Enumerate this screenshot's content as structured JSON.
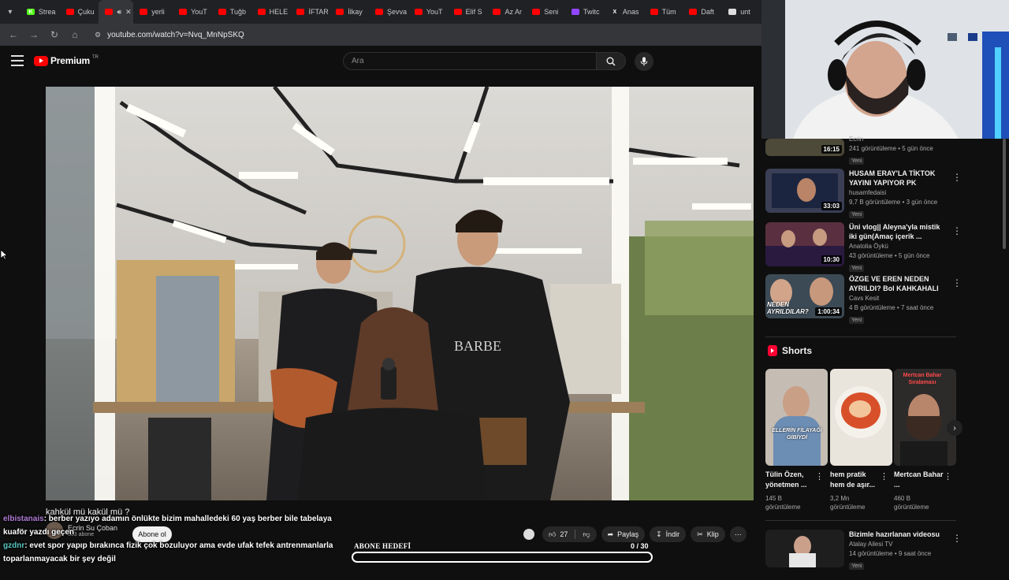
{
  "tabs": [
    {
      "label": "Strea",
      "fav": "K",
      "color": "#53fc18"
    },
    {
      "label": "Çuku",
      "fav": "",
      "color": "#ff0000"
    },
    {
      "label": "",
      "fav": "",
      "color": "#ff0000",
      "active": true
    },
    {
      "label": "yerli",
      "fav": "",
      "color": "#ff0000"
    },
    {
      "label": "YouT",
      "fav": "",
      "color": "#ff0000"
    },
    {
      "label": "Tuğb",
      "fav": "",
      "color": "#ff0000"
    },
    {
      "label": "HELE",
      "fav": "",
      "color": "#ff0000"
    },
    {
      "label": "İFTAR",
      "fav": "",
      "color": "#ff0000"
    },
    {
      "label": "İlkay",
      "fav": "",
      "color": "#ff0000"
    },
    {
      "label": "Şevva",
      "fav": "",
      "color": "#ff0000"
    },
    {
      "label": "YouT",
      "fav": "",
      "color": "#ff0000"
    },
    {
      "label": "Elif S",
      "fav": "",
      "color": "#ff0000"
    },
    {
      "label": "Az Ar",
      "fav": "",
      "color": "#ff0000"
    },
    {
      "label": "Seni",
      "fav": "",
      "color": "#ff0000"
    },
    {
      "label": "Twitc",
      "fav": "",
      "color": "#9146ff"
    },
    {
      "label": "Anas",
      "fav": "X",
      "color": "#202124"
    },
    {
      "label": "Tüm",
      "fav": "",
      "color": "#ff0000"
    },
    {
      "label": "Daft",
      "fav": "",
      "color": "#ff0000"
    },
    {
      "label": "unt",
      "fav": "",
      "color": "#dddddd"
    }
  ],
  "address": {
    "url": "youtube.com/watch?v=Nvq_MnNpSKQ"
  },
  "header": {
    "brand": "Premium",
    "region": "TR",
    "search_placeholder": "Ara"
  },
  "video": {
    "title": "kahkül mü kakül mü ?"
  },
  "channel": {
    "name": "Ecrin Su Çoban",
    "subs": "503 abone",
    "subscribe_label": "Abone ol"
  },
  "actions": {
    "likes": "27",
    "share": "Paylaş",
    "download": "İndir",
    "clip": "Klip"
  },
  "chat": [
    {
      "user": "elbistanais",
      "text": ": berber yazıyo adamın önlükte bizim mahalledeki 60 yaş berber bile tabelaya kuaför yazdı geçen"
    },
    {
      "user": "gzdnr",
      "text": ": evet spor yapıp bırakınca fizik çok bozuluyor ama evde ufak tefek antrenmanlarla toparlanmayacak bir şey değil"
    }
  ],
  "goal": {
    "label": "ABONE HEDEFİ",
    "count": "0 / 30",
    "fraction": 0
  },
  "sidebar": {
    "videos": [
      {
        "title": "",
        "channel": "Ecrin",
        "stats": "241 görüntüleme • 5 gün önce",
        "badge": "Yeni",
        "duration": "16:15"
      },
      {
        "title": "HUSAM ERAY'LA TİKTOK YAYINI YAPIYOR PK ATIYORLA...",
        "channel": "husamfedaisi",
        "stats": "9,7 B görüntüleme • 3 gün önce",
        "badge": "Yeni",
        "duration": "33:03"
      },
      {
        "title": "Üni vlog|| Aleyna'yla mistik iki gün(Amaç içerik ...",
        "channel": "Anatolia Öykü",
        "stats": "43 görüntüleme • 5 gün önce",
        "badge": "Yeni",
        "duration": "10:30"
      },
      {
        "title": "ÖZGE VE EREN NEDEN AYRILDI? Bol KAHKAHALI Yeni...",
        "channel": "Cavs Kesit",
        "stats": "4 B görüntüleme • 7 saat önce",
        "badge": "Yeni",
        "duration": "1:00:34",
        "thumb_text": "NEDEN AYRILDILAR?"
      },
      {
        "title": "Bizimle hazırlanan videosu",
        "channel": "Atalay Ailesi TV",
        "stats": "14 görüntüleme • 9 saat önce",
        "badge": "Yeni",
        "duration": ""
      }
    ],
    "shorts_heading": "Shorts",
    "shorts": [
      {
        "title": "Tülin Özen, yönetmen ...",
        "views": "145 B görüntüleme",
        "thumb_text": "ELLERİN FİLAYAĞI GİBİYDİ"
      },
      {
        "title": "hem pratik hem de aşır...",
        "views": "3,2 Mn görüntüleme",
        "thumb_text": ""
      },
      {
        "title": "Mertcan Bahar ...",
        "views": "460 B görüntüleme",
        "thumb_text": "Mertcan Bahar Sıralaması"
      }
    ]
  }
}
